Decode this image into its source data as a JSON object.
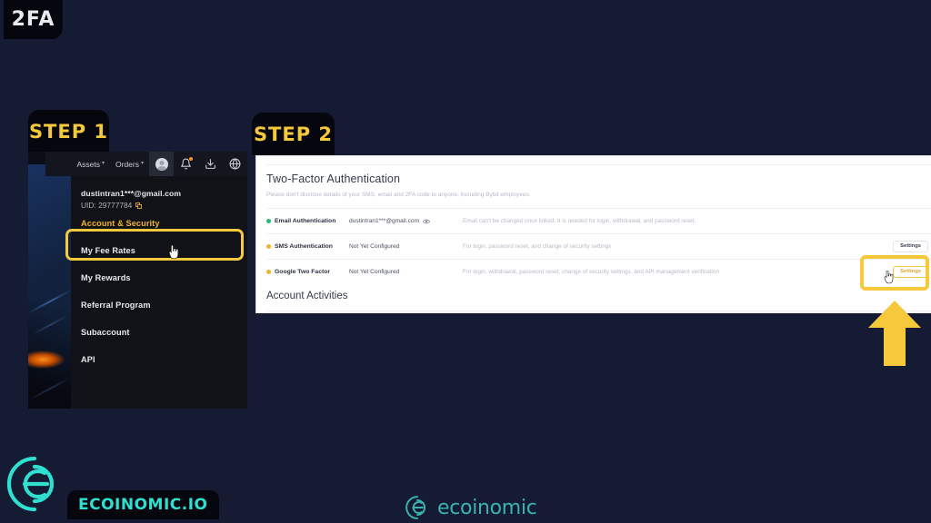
{
  "badges": {
    "topic": "2FA",
    "step1": "STEP 1",
    "step2": "STEP 2"
  },
  "colors": {
    "page_bg": "#141b33",
    "accent_yellow": "#f6c83c",
    "panel_bg": "#ffffff",
    "menu_bg": "#101218",
    "brand_teal": "#2fe0d0",
    "status_green": "#2bb673",
    "status_yellow": "#f0b429"
  },
  "app_left": {
    "topnav": {
      "items": [
        {
          "label": "Assets",
          "icon": "chevron-down-icon",
          "has_caret": true
        },
        {
          "label": "Orders",
          "icon": "chevron-down-icon",
          "has_caret": true
        }
      ],
      "icons": [
        {
          "name": "user-avatar-icon",
          "active": true
        },
        {
          "name": "bell-notification-icon",
          "has_dot": true
        },
        {
          "name": "download-icon",
          "has_dot": false
        },
        {
          "name": "globe-language-icon",
          "has_dot": false
        }
      ]
    },
    "account": {
      "email": "dustintran1***@gmail.com",
      "uid_label": "UID: 29777784",
      "copy_icon": "copy-icon"
    },
    "menu": [
      {
        "label": "Account & Security",
        "active": true
      },
      {
        "label": "My Fee Rates",
        "active": false
      },
      {
        "label": "My Rewards",
        "active": false
      },
      {
        "label": "Referral Program",
        "active": false
      },
      {
        "label": "Subaccount",
        "active": false
      },
      {
        "label": "API",
        "active": false
      }
    ]
  },
  "panel": {
    "title": "Two-Factor Authentication",
    "note": "Please don't disclose details of your SMS, email and 2FA code to anyone, including Bybit employees.",
    "rows": [
      {
        "status": "green",
        "label": "Email Authentication",
        "value": "dustintran1***@gmail.com",
        "value_icon": "eye-icon",
        "description": "Email can't be changed once linked. It is needed for login, withdrawal, and password reset.",
        "action": "",
        "highlighted": false
      },
      {
        "status": "yellow",
        "label": "SMS Authentication",
        "value": "Not Yet Configured",
        "value_icon": "",
        "description": "For login, password reset, and change of security settings",
        "action": "Settings",
        "highlighted": false
      },
      {
        "status": "yellow",
        "label": "Google Two Factor",
        "value": "Not Yet Configured",
        "value_icon": "",
        "description": "For login, withdrawal, password reset, change of security settings, and API management verification",
        "action": "Settings",
        "highlighted": true
      }
    ],
    "subtitle": "Account Activities"
  },
  "branding": {
    "wordmark_left": "ECOINOMIC.IO",
    "wordmark_center": "ecoinomic"
  }
}
